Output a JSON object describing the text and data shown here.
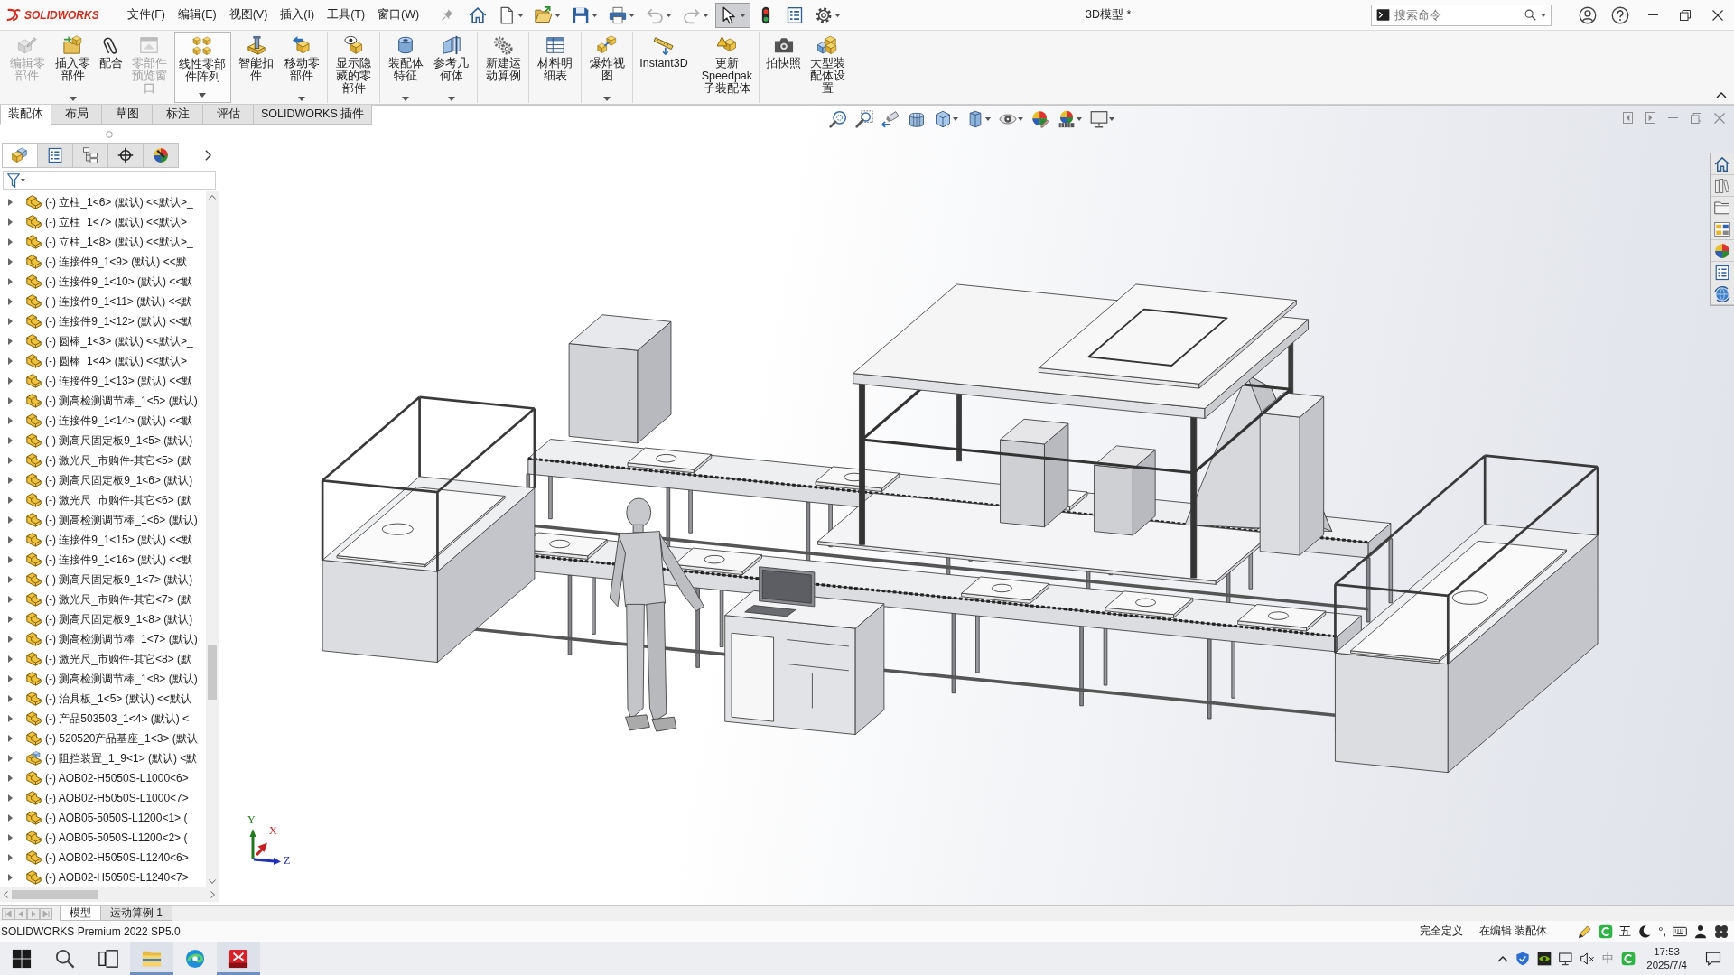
{
  "app": {
    "logo_text": "SOLIDWORKS"
  },
  "menu": [
    {
      "label": "文件(F)"
    },
    {
      "label": "编辑(E)"
    },
    {
      "label": "视图(V)"
    },
    {
      "label": "插入(I)"
    },
    {
      "label": "工具(T)"
    },
    {
      "label": "窗口(W)"
    }
  ],
  "quick_access": [
    {
      "kind": "home",
      "dropdown": false,
      "disabled": false,
      "selected": false
    },
    {
      "kind": "new",
      "dropdown": true,
      "disabled": false,
      "selected": false
    },
    {
      "kind": "open",
      "dropdown": true,
      "disabled": false,
      "selected": false
    },
    {
      "kind": "save",
      "dropdown": true,
      "disabled": false,
      "selected": false
    },
    {
      "kind": "print",
      "dropdown": true,
      "disabled": false,
      "selected": false
    },
    {
      "kind": "undo",
      "dropdown": true,
      "disabled": true,
      "selected": false
    },
    {
      "kind": "redo",
      "dropdown": true,
      "disabled": true,
      "selected": false
    },
    {
      "kind": "select",
      "dropdown": true,
      "disabled": false,
      "selected": true
    },
    {
      "kind": "rebuild",
      "dropdown": false,
      "disabled": false,
      "selected": false
    },
    {
      "kind": "file-properties",
      "dropdown": false,
      "disabled": false,
      "selected": false
    },
    {
      "kind": "options",
      "dropdown": true,
      "disabled": false,
      "selected": false
    }
  ],
  "title": "3D模型 *",
  "search": {
    "placeholder": "搜索命令"
  },
  "ribbon": [
    {
      "buttons": [
        {
          "label": "编辑零部件",
          "kind": "edit-part",
          "disabled": true,
          "dropdown": false,
          "split": false
        },
        {
          "label": "插入零部件",
          "kind": "insert-part",
          "disabled": false,
          "dropdown": true,
          "split": false
        },
        {
          "label": "配合",
          "kind": "mate",
          "disabled": false,
          "dropdown": false,
          "split": false
        },
        {
          "label": "零部件预览窗口",
          "kind": "preview-window",
          "disabled": true,
          "dropdown": false,
          "split": false
        },
        {
          "label": "线性零部件阵列",
          "kind": "linear-pattern",
          "disabled": false,
          "dropdown": true,
          "split": true
        },
        {
          "label": "智能扣件",
          "kind": "smart-fastener",
          "disabled": false,
          "dropdown": false,
          "split": false
        },
        {
          "label": "移动零部件",
          "kind": "move-component",
          "disabled": false,
          "dropdown": true,
          "split": false
        }
      ]
    },
    {
      "buttons": [
        {
          "label": "显示隐藏的零部件",
          "kind": "show-hidden",
          "disabled": false,
          "dropdown": false,
          "split": false
        }
      ]
    },
    {
      "buttons": [
        {
          "label": "装配体特征",
          "kind": "assembly-features",
          "disabled": false,
          "dropdown": true,
          "split": false
        },
        {
          "label": "参考几何体",
          "kind": "reference-geometry",
          "disabled": false,
          "dropdown": true,
          "split": false
        }
      ]
    },
    {
      "buttons": [
        {
          "label": "新建运动算例",
          "kind": "motion-study",
          "disabled": false,
          "dropdown": false,
          "split": false
        }
      ]
    },
    {
      "buttons": [
        {
          "label": "材料明细表",
          "kind": "bom",
          "disabled": false,
          "dropdown": false,
          "split": false
        }
      ]
    },
    {
      "buttons": [
        {
          "label": "爆炸视图",
          "kind": "exploded-view",
          "disabled": false,
          "dropdown": true,
          "split": false
        }
      ]
    },
    {
      "buttons": [
        {
          "label": "Instant3D",
          "kind": "instant3d",
          "disabled": false,
          "dropdown": false,
          "split": false
        }
      ]
    },
    {
      "buttons": [
        {
          "label": "更新Speedpak子装配体",
          "kind": "speedpak",
          "disabled": false,
          "dropdown": false,
          "split": false
        }
      ]
    },
    {
      "buttons": [
        {
          "label": "拍快照",
          "kind": "snapshot",
          "disabled": false,
          "dropdown": false,
          "split": false
        },
        {
          "label": "大型装配体设置",
          "kind": "large-assembly",
          "disabled": false,
          "dropdown": false,
          "split": false
        }
      ]
    }
  ],
  "ribbon_tabs": [
    {
      "label": "装配体",
      "selected": true
    },
    {
      "label": "布局",
      "selected": false
    },
    {
      "label": "草图",
      "selected": false
    },
    {
      "label": "标注",
      "selected": false
    },
    {
      "label": "评估",
      "selected": false
    },
    {
      "label": "SOLIDWORKS 插件",
      "selected": false
    }
  ],
  "feature_manager": {
    "tabs": [
      {
        "kind": "feature-tree",
        "selected": true
      },
      {
        "kind": "property-manager",
        "selected": false
      },
      {
        "kind": "configuration-manager",
        "selected": false
      },
      {
        "kind": "dimxpert",
        "selected": false
      },
      {
        "kind": "display-manager",
        "selected": false
      }
    ],
    "tree": [
      {
        "label": "(-) 立柱_1<6> (默认) <<默认>_",
        "kind": "part",
        "expanded": false
      },
      {
        "label": "(-) 立柱_1<7> (默认) <<默认>_",
        "kind": "part",
        "expanded": false
      },
      {
        "label": "(-) 立柱_1<8> (默认) <<默认>_",
        "kind": "part",
        "expanded": false
      },
      {
        "label": "(-) 连接件9_1<9> (默认) <<默",
        "kind": "part",
        "expanded": false
      },
      {
        "label": "(-) 连接件9_1<10> (默认) <<默",
        "kind": "part",
        "expanded": false
      },
      {
        "label": "(-) 连接件9_1<11> (默认) <<默",
        "kind": "part",
        "expanded": false
      },
      {
        "label": "(-) 连接件9_1<12> (默认) <<默",
        "kind": "part",
        "expanded": false
      },
      {
        "label": "(-) 圆棒_1<3> (默认) <<默认>_",
        "kind": "part",
        "expanded": false
      },
      {
        "label": "(-) 圆棒_1<4> (默认) <<默认>_",
        "kind": "part",
        "expanded": false
      },
      {
        "label": "(-) 连接件9_1<13> (默认) <<默",
        "kind": "part",
        "expanded": false
      },
      {
        "label": "(-) 测高检测调节棒_1<5> (默认)",
        "kind": "part",
        "expanded": false
      },
      {
        "label": "(-) 连接件9_1<14> (默认) <<默",
        "kind": "part",
        "expanded": false
      },
      {
        "label": "(-) 测高尺固定板9_1<5> (默认)",
        "kind": "part",
        "expanded": false
      },
      {
        "label": "(-) 激光尺_市购件-其它<5> (默",
        "kind": "part",
        "expanded": false
      },
      {
        "label": "(-) 测高尺固定板9_1<6> (默认)",
        "kind": "part",
        "expanded": false
      },
      {
        "label": "(-) 激光尺_市购件-其它<6> (默",
        "kind": "part",
        "expanded": false
      },
      {
        "label": "(-) 测高检测调节棒_1<6> (默认)",
        "kind": "part",
        "expanded": false
      },
      {
        "label": "(-) 连接件9_1<15> (默认) <<默",
        "kind": "part",
        "expanded": false
      },
      {
        "label": "(-) 连接件9_1<16> (默认) <<默",
        "kind": "part",
        "expanded": false
      },
      {
        "label": "(-) 测高尺固定板9_1<7> (默认)",
        "kind": "part",
        "expanded": false
      },
      {
        "label": "(-) 激光尺_市购件-其它<7> (默",
        "kind": "part",
        "expanded": false
      },
      {
        "label": "(-) 测高尺固定板9_1<8> (默认)",
        "kind": "part",
        "expanded": false
      },
      {
        "label": "(-) 测高检测调节棒_1<7> (默认)",
        "kind": "part",
        "expanded": false
      },
      {
        "label": "(-) 激光尺_市购件-其它<8> (默",
        "kind": "part",
        "expanded": false
      },
      {
        "label": "(-) 测高检测调节棒_1<8> (默认)",
        "kind": "part",
        "expanded": false
      },
      {
        "label": "(-) 治具板_1<5> (默认) <<默认",
        "kind": "part",
        "expanded": false
      },
      {
        "label": "(-) 产品503503_1<4> (默认) <",
        "kind": "part",
        "expanded": false
      },
      {
        "label": "(-) 520520产品基座_1<3> (默认",
        "kind": "part",
        "expanded": false
      },
      {
        "label": "(-) 阻挡装置_1_9<1> (默认) <默",
        "kind": "assembly",
        "expanded": false
      },
      {
        "label": "(-) AOB02-H5050S-L1000<6>",
        "kind": "part",
        "expanded": false
      },
      {
        "label": "(-) AOB02-H5050S-L1000<7>",
        "kind": "part",
        "expanded": false
      },
      {
        "label": "(-) AOB05-5050S-L1200<1> (",
        "kind": "part",
        "expanded": false
      },
      {
        "label": "(-) AOB05-5050S-L1200<2> (",
        "kind": "part",
        "expanded": false
      },
      {
        "label": "(-) AOB02-H5050S-L1240<6>",
        "kind": "part",
        "expanded": false
      },
      {
        "label": "(-) AOB02-H5050S-L1240<7>",
        "kind": "part",
        "expanded": false
      }
    ]
  },
  "view_toolbar": [
    {
      "kind": "zoom-fit",
      "dropdown": false
    },
    {
      "kind": "zoom-area",
      "dropdown": false
    },
    {
      "kind": "previous-view",
      "dropdown": false
    },
    {
      "kind": "section-view",
      "dropdown": false
    },
    {
      "kind": "view-orientation",
      "dropdown": true
    },
    {
      "kind": "display-style",
      "dropdown": true
    },
    {
      "kind": "hide-show",
      "dropdown": true
    },
    {
      "kind": "edit-appearance",
      "dropdown": false
    },
    {
      "kind": "scene",
      "dropdown": true
    },
    {
      "kind": "view-settings",
      "dropdown": true
    }
  ],
  "task_pane": [
    {
      "kind": "home"
    },
    {
      "kind": "design-library"
    },
    {
      "kind": "file-explorer"
    },
    {
      "kind": "view-palette"
    },
    {
      "kind": "appearances"
    },
    {
      "kind": "custom-properties"
    },
    {
      "kind": "forum"
    }
  ],
  "triad": {
    "axes": [
      {
        "label": "Y",
        "color": "#1f7a1f"
      },
      {
        "label": "X",
        "color": "#c42020"
      },
      {
        "label": "Z",
        "color": "#2030b8"
      }
    ]
  },
  "bottom_tabs": [
    {
      "label": "模型",
      "selected": true
    },
    {
      "label": "运动算例 1",
      "selected": false
    }
  ],
  "status_bar": {
    "product": "SOLIDWORKS Premium 2022 SP5.0",
    "items": [
      {
        "label": "完全定义"
      },
      {
        "label": "在编辑 装配体"
      }
    ],
    "ime": [
      {
        "kind": "pen"
      },
      {
        "kind": "sogou"
      },
      {
        "kind": "text",
        "label": "五"
      },
      {
        "kind": "moon"
      },
      {
        "kind": "text",
        "label": "°,"
      },
      {
        "kind": "keyboard"
      },
      {
        "kind": "person"
      },
      {
        "kind": "clover"
      }
    ]
  },
  "taskbar": {
    "apps": [
      {
        "kind": "start",
        "active": false
      },
      {
        "kind": "search",
        "active": false
      },
      {
        "kind": "task-view",
        "active": false
      },
      {
        "kind": "explorer",
        "active": true
      },
      {
        "kind": "edge",
        "active": false
      },
      {
        "kind": "solidworks",
        "active": true
      }
    ],
    "tray": [
      {
        "kind": "chevron"
      },
      {
        "kind": "shield"
      },
      {
        "kind": "nvidia"
      },
      {
        "kind": "network"
      },
      {
        "kind": "speaker"
      },
      {
        "kind": "text",
        "label": "中"
      },
      {
        "kind": "sogou"
      }
    ],
    "time": "17:53",
    "date": "2025/7/4"
  }
}
